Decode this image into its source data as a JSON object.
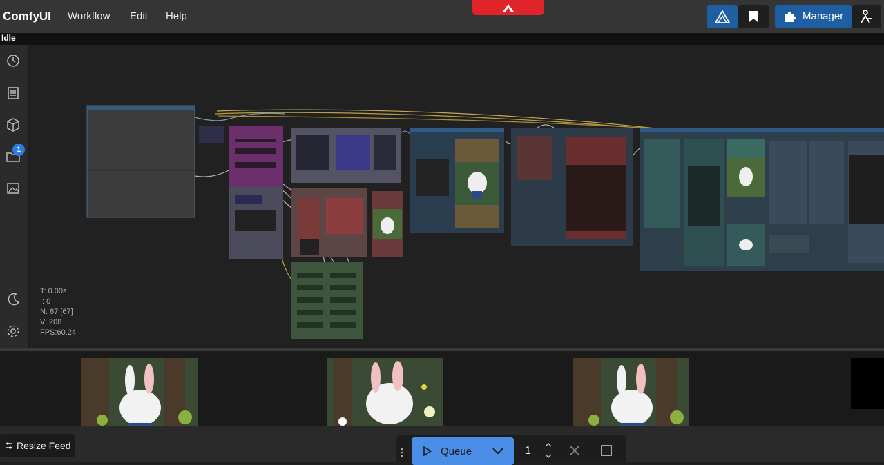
{
  "app": {
    "title": "ComfyUI"
  },
  "menu": {
    "items": [
      "Workflow",
      "Edit",
      "Help"
    ]
  },
  "toolbar": {
    "manager_label": "Manager"
  },
  "status": {
    "text": "Idle"
  },
  "sidebar": {
    "icons": [
      "history-icon",
      "document-icon",
      "cube-icon",
      "folder-icon",
      "gallery-icon",
      "moon-icon",
      "gear-icon"
    ],
    "badge_count": "1"
  },
  "stats": {
    "t": "T: 0.00s",
    "i": "I: 0",
    "n": "N: 67 [67]",
    "v": "V: 208",
    "fps": "FPS:60.24"
  },
  "feed": {
    "resize_label": "Resize Feed"
  },
  "queue": {
    "label": "Queue",
    "count": "1"
  },
  "colors": {
    "accent": "#4a8ee8",
    "manager": "#1e5fa3",
    "alert": "#e0242a"
  }
}
